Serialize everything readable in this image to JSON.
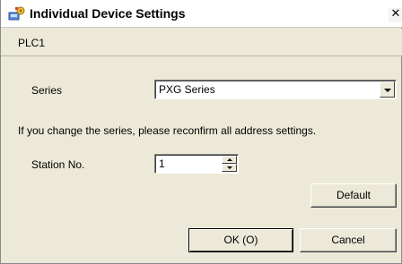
{
  "window": {
    "title": "Individual Device Settings",
    "close_glyph": "✕"
  },
  "section": {
    "label": "PLC1"
  },
  "form": {
    "series_label": "Series",
    "series_value": "PXG Series",
    "notice": "If you change the series, please reconfirm all address settings.",
    "station_label": "Station No.",
    "station_value": "1"
  },
  "buttons": {
    "default_label": "Default",
    "ok_label": "OK (O)",
    "cancel_label": "Cancel"
  },
  "icons": {
    "title_icon": "device-settings-icon",
    "combo_arrow": "chevron-down-icon"
  }
}
